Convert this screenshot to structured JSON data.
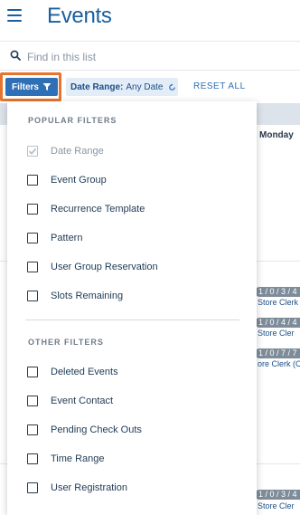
{
  "header": {
    "title": "Events",
    "menu_icon": "hamburger-menu-icon"
  },
  "search": {
    "placeholder": "Find in this list",
    "value": "",
    "icon": "search-icon"
  },
  "filterbar": {
    "filters_label": "Filters",
    "filters_icon": "funnel-icon",
    "chip_key": "Date Range:",
    "chip_value": "Any Date",
    "chip_icon": "reset-circle-icon",
    "reset_all_label": "RESET ALL"
  },
  "calendar": {
    "day_label": "Monday",
    "events": [
      {
        "pill": "1 / 0 / 3 / 4",
        "text": "Store Clerk"
      },
      {
        "pill": "1 / 0 / 4 / 4",
        "text": "Store Cler"
      },
      {
        "pill": "1 / 0 / 7 / 7",
        "text": "ore Clerk (C"
      },
      {
        "pill": "1 / 0 / 3 / 4",
        "text": "Store Cler"
      }
    ]
  },
  "dropdown": {
    "popular_title": "POPULAR FILTERS",
    "popular": [
      {
        "label": "Date Range",
        "checked": true,
        "disabled": true
      },
      {
        "label": "Event Group",
        "checked": false
      },
      {
        "label": "Recurrence Template",
        "checked": false
      },
      {
        "label": "Pattern",
        "checked": false
      },
      {
        "label": "User Group Reservation",
        "checked": false
      },
      {
        "label": "Slots Remaining",
        "checked": false
      }
    ],
    "other_title": "OTHER FILTERS",
    "other": [
      {
        "label": "Deleted Events",
        "checked": false
      },
      {
        "label": "Event Contact",
        "checked": false
      },
      {
        "label": "Pending Check Outs",
        "checked": false
      },
      {
        "label": "Time Range",
        "checked": false
      },
      {
        "label": "User Registration",
        "checked": false
      }
    ]
  },
  "colors": {
    "accent": "#2f6fb5",
    "highlight": "#e8732c",
    "title": "#1a5fa0"
  }
}
